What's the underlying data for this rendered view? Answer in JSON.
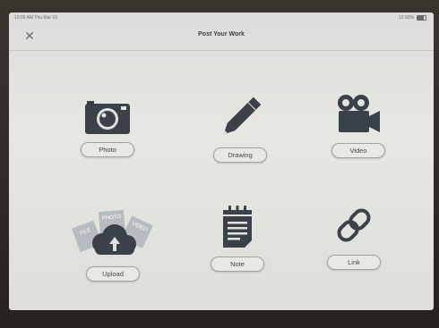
{
  "status": {
    "time_date": "10:55 AM  Thu Mar 16",
    "battery": "10 60%"
  },
  "header": {
    "close_icon": "close-icon",
    "title": "Post Your Work"
  },
  "options": [
    {
      "label": "Photo",
      "icon": "camera-icon"
    },
    {
      "label": "Drawing",
      "icon": "pencil-icon"
    },
    {
      "label": "Video",
      "icon": "video-camera-icon"
    },
    {
      "label": "Upload",
      "icon": "cloud-upload-icon",
      "badges": [
        "FILE",
        "PHOTO",
        "VIDEO"
      ]
    },
    {
      "label": "Note",
      "icon": "notepad-icon"
    },
    {
      "label": "Link",
      "icon": "link-icon"
    }
  ],
  "colors": {
    "icon": "#3a4148",
    "screen": "#e2e2df",
    "text": "#444444"
  }
}
